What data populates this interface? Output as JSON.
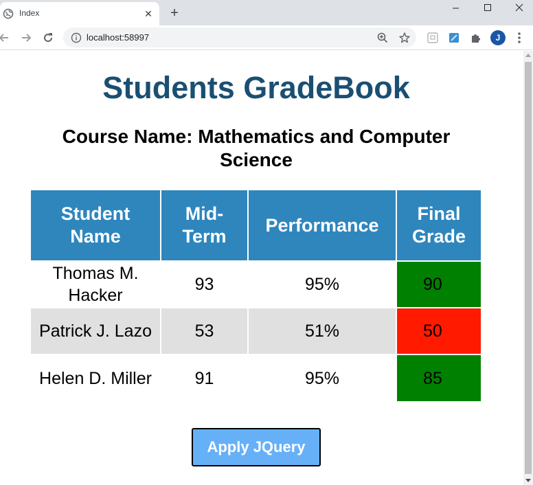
{
  "browser": {
    "tab_title": "Index",
    "url": "localhost:58997",
    "avatar_letter": "J"
  },
  "page": {
    "title": "Students GradeBook",
    "course_label": "Course Name: Mathematics and Computer Science",
    "table": {
      "headers": [
        "Student Name",
        "Mid-Term",
        "Performance",
        "Final Grade"
      ],
      "rows": [
        {
          "name": "Thomas M. Hacker",
          "midterm": "93",
          "performance": "95%",
          "final": "90",
          "status": "pass"
        },
        {
          "name": "Patrick J. Lazo",
          "midterm": "53",
          "performance": "51%",
          "final": "50",
          "status": "fail"
        },
        {
          "name": "Helen D. Miller",
          "midterm": "91",
          "performance": "95%",
          "final": "85",
          "status": "pass"
        }
      ]
    },
    "button_label": "Apply JQuery"
  },
  "colors": {
    "title": "#1a4f72",
    "header_bg": "#2e86bd",
    "pass": "#008000",
    "fail": "#ff1a00",
    "button_bg": "#66b0f8"
  }
}
